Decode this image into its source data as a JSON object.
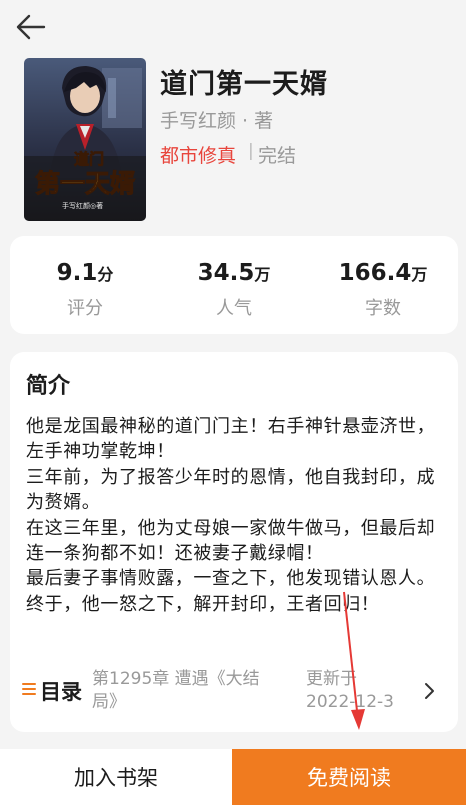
{
  "book": {
    "title": "道门第一天婿",
    "author": "手写红颜 · 著",
    "genre": "都市修真",
    "separator": "|",
    "status": "完结",
    "cover": {
      "title_small": "道门",
      "title_big": "第一天婿",
      "author_tag": "手写红颜◎著"
    }
  },
  "stats": [
    {
      "value": "9.1",
      "unit": "分",
      "label": "评分"
    },
    {
      "value": "34.5",
      "unit": "万",
      "label": "人气"
    },
    {
      "value": "166.4",
      "unit": "万",
      "label": "字数"
    }
  ],
  "intro": {
    "heading": "简介",
    "lines": [
      "他是龙国最神秘的道门门主！右手神针悬壶济世，",
      "左手神功掌乾坤！",
      "三年前，为了报答少年时的恩情，他自我封印，成",
      "为赘婿。",
      "在这三年里，他为丈母娘一家做牛做马，但最后却",
      "连一条狗都不如！还被妻子戴绿帽！",
      "最后妻子事情败露，一查之下，他发现错认恩人。",
      "终于，他一怒之下，解开封印，王者回归！"
    ]
  },
  "toc": {
    "label": "目录",
    "latest_chapter": "第1295章 遭遇《大结局》",
    "update_label": "更新于",
    "update_date": "2022-12-3"
  },
  "actions": {
    "add_shelf": "加入书架",
    "free_read": "免费阅读"
  },
  "colors": {
    "accent": "#f07b1f",
    "genre": "#e8453c",
    "annotation_arrow": "#e53935"
  },
  "icons": [
    "back-arrow-icon",
    "toc-list-icon",
    "chevron-right-icon"
  ]
}
